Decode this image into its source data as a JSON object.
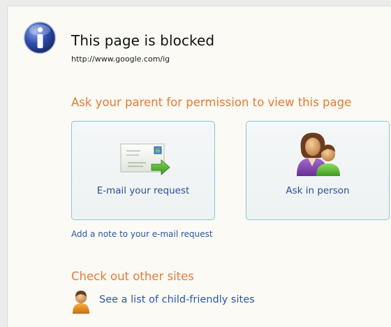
{
  "page": {
    "title": "This page is blocked",
    "url": "http://www.google.com/ig"
  },
  "permission": {
    "heading": "Ask your parent for permission to view this page",
    "email_label": "E-mail your request",
    "person_label": "Ask in person",
    "note_link": "Add a note to your e-mail request"
  },
  "other_sites": {
    "heading": "Check out other sites",
    "link": "See a list of child-friendly sites"
  },
  "colors": {
    "heading": "#e57b33",
    "link": "#2a57a8",
    "card_border": "#8ac7d2",
    "info_icon": "#2f4fae"
  },
  "icons": [
    "info-icon",
    "envelope-arrow-icon",
    "parent-child-icon",
    "child-avatar-icon"
  ]
}
